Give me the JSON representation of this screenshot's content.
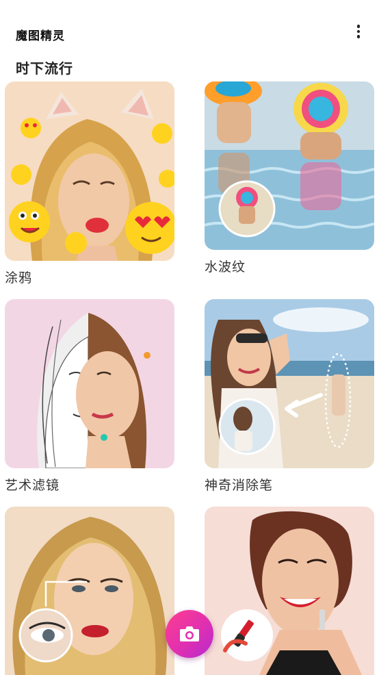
{
  "app": {
    "title": "魔图精灵"
  },
  "header": {
    "more_icon": "more-vertical-icon"
  },
  "section": {
    "title": "时下流行"
  },
  "cards": [
    {
      "label": "涂鸦"
    },
    {
      "label": "水波纹"
    },
    {
      "label": "艺术滤镜"
    },
    {
      "label": "神奇消除笔"
    },
    {
      "label": ""
    },
    {
      "label": ""
    }
  ],
  "fab": {
    "icon": "camera-icon",
    "color": "#e030b0"
  }
}
